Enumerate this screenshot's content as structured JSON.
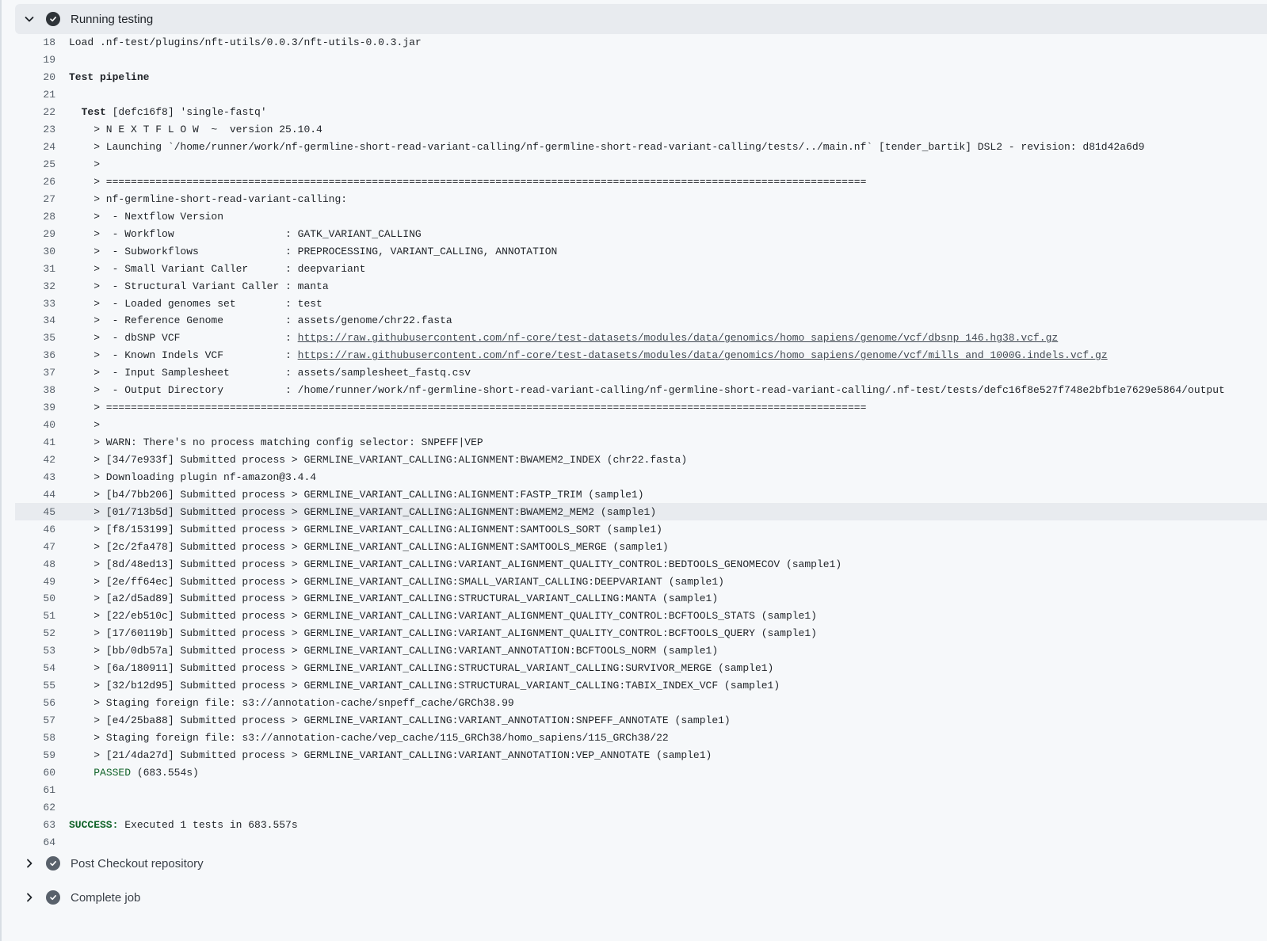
{
  "steps": {
    "running": {
      "title": "Running testing",
      "state": "expanded"
    },
    "post_checkout": {
      "title": "Post Checkout repository",
      "state": "collapsed"
    },
    "complete": {
      "title": "Complete job",
      "state": "collapsed"
    }
  },
  "highlighted_line": "45",
  "log_lines": [
    {
      "n": "18",
      "t": "Load .nf-test/plugins/nft-utils/0.0.3/nft-utils-0.0.3.jar"
    },
    {
      "n": "19",
      "t": ""
    },
    {
      "n": "20",
      "p": "Test pipeline"
    },
    {
      "n": "21",
      "t": ""
    },
    {
      "n": "22",
      "t": "  ",
      "p": "Test",
      "t2": " [defc16f8] 'single-fastq'"
    },
    {
      "n": "23",
      "t": "    > N E X T F L O W  ~  version 25.10.4"
    },
    {
      "n": "24",
      "t": "    > Launching `/home/runner/work/nf-germline-short-read-variant-calling/nf-germline-short-read-variant-calling/tests/../main.nf` [tender_bartik] DSL2 - revision: d81d42a6d9"
    },
    {
      "n": "25",
      "t": "    >"
    },
    {
      "n": "26",
      "t": "    > ==========================================================================================================================="
    },
    {
      "n": "27",
      "t": "    > nf-germline-short-read-variant-calling:"
    },
    {
      "n": "28",
      "t": "    >  - Nextflow Version"
    },
    {
      "n": "29",
      "t": "    >  - Workflow                  : GATK_VARIANT_CALLING"
    },
    {
      "n": "30",
      "t": "    >  - Subworkflows              : PREPROCESSING, VARIANT_CALLING, ANNOTATION"
    },
    {
      "n": "31",
      "t": "    >  - Small Variant Caller      : deepvariant"
    },
    {
      "n": "32",
      "t": "    >  - Structural Variant Caller : manta"
    },
    {
      "n": "33",
      "t": "    >  - Loaded genomes set        : test"
    },
    {
      "n": "34",
      "t": "    >  - Reference Genome          : assets/genome/chr22.fasta"
    },
    {
      "n": "35",
      "t": "    >  - dbSNP VCF                 : ",
      "l": "https://raw.githubusercontent.com/nf-core/test-datasets/modules/data/genomics/homo_sapiens/genome/vcf/dbsnp_146.hg38.vcf.gz"
    },
    {
      "n": "36",
      "t": "    >  - Known Indels VCF          : ",
      "l": "https://raw.githubusercontent.com/nf-core/test-datasets/modules/data/genomics/homo_sapiens/genome/vcf/mills_and_1000G.indels.vcf.gz"
    },
    {
      "n": "37",
      "t": "    >  - Input Samplesheet         : assets/samplesheet_fastq.csv"
    },
    {
      "n": "38",
      "t": "    >  - Output Directory          : /home/runner/work/nf-germline-short-read-variant-calling/nf-germline-short-read-variant-calling/.nf-test/tests/defc16f8e527f748e2bfb1e7629e5864/output"
    },
    {
      "n": "39",
      "t": "    > ==========================================================================================================================="
    },
    {
      "n": "40",
      "t": "    >"
    },
    {
      "n": "41",
      "t": "    > WARN: There's no process matching config selector: SNPEFF|VEP"
    },
    {
      "n": "42",
      "t": "    > [34/7e933f] Submitted process > GERMLINE_VARIANT_CALLING:ALIGNMENT:BWAMEM2_INDEX (chr22.fasta)"
    },
    {
      "n": "43",
      "t": "    > Downloading plugin nf-amazon@3.4.4"
    },
    {
      "n": "44",
      "t": "    > [b4/7bb206] Submitted process > GERMLINE_VARIANT_CALLING:ALIGNMENT:FASTP_TRIM (sample1)"
    },
    {
      "n": "45",
      "t": "    > [01/713b5d] Submitted process > GERMLINE_VARIANT_CALLING:ALIGNMENT:BWAMEM2_MEM2 (sample1)"
    },
    {
      "n": "46",
      "t": "    > [f8/153199] Submitted process > GERMLINE_VARIANT_CALLING:ALIGNMENT:SAMTOOLS_SORT (sample1)"
    },
    {
      "n": "47",
      "t": "    > [2c/2fa478] Submitted process > GERMLINE_VARIANT_CALLING:ALIGNMENT:SAMTOOLS_MERGE (sample1)"
    },
    {
      "n": "48",
      "t": "    > [8d/48ed13] Submitted process > GERMLINE_VARIANT_CALLING:VARIANT_ALIGNMENT_QUALITY_CONTROL:BEDTOOLS_GENOMECOV (sample1)"
    },
    {
      "n": "49",
      "t": "    > [2e/ff64ec] Submitted process > GERMLINE_VARIANT_CALLING:SMALL_VARIANT_CALLING:DEEPVARIANT (sample1)"
    },
    {
      "n": "50",
      "t": "    > [a2/d5ad89] Submitted process > GERMLINE_VARIANT_CALLING:STRUCTURAL_VARIANT_CALLING:MANTA (sample1)"
    },
    {
      "n": "51",
      "t": "    > [22/eb510c] Submitted process > GERMLINE_VARIANT_CALLING:VARIANT_ALIGNMENT_QUALITY_CONTROL:BCFTOOLS_STATS (sample1)"
    },
    {
      "n": "52",
      "t": "    > [17/60119b] Submitted process > GERMLINE_VARIANT_CALLING:VARIANT_ALIGNMENT_QUALITY_CONTROL:BCFTOOLS_QUERY (sample1)"
    },
    {
      "n": "53",
      "t": "    > [bb/0db57a] Submitted process > GERMLINE_VARIANT_CALLING:VARIANT_ANNOTATION:BCFTOOLS_NORM (sample1)"
    },
    {
      "n": "54",
      "t": "    > [6a/180911] Submitted process > GERMLINE_VARIANT_CALLING:STRUCTURAL_VARIANT_CALLING:SURVIVOR_MERGE (sample1)"
    },
    {
      "n": "55",
      "t": "    > [32/b12d95] Submitted process > GERMLINE_VARIANT_CALLING:STRUCTURAL_VARIANT_CALLING:TABIX_INDEX_VCF (sample1)"
    },
    {
      "n": "56",
      "t": "    > Staging foreign file: s3://annotation-cache/snpeff_cache/GRCh38.99"
    },
    {
      "n": "57",
      "t": "    > [e4/25ba88] Submitted process > GERMLINE_VARIANT_CALLING:VARIANT_ANNOTATION:SNPEFF_ANNOTATE (sample1)"
    },
    {
      "n": "58",
      "t": "    > Staging foreign file: s3://annotation-cache/vep_cache/115_GRCh38/homo_sapiens/115_GRCh38/22"
    },
    {
      "n": "59",
      "t": "    > [21/4da27d] Submitted process > GERMLINE_VARIANT_CALLING:VARIANT_ANNOTATION:VEP_ANNOTATE (sample1)"
    },
    {
      "n": "60",
      "t": "    ",
      "g": "PASSED",
      "t2": " (683.554s)"
    },
    {
      "n": "61",
      "t": ""
    },
    {
      "n": "62",
      "t": ""
    },
    {
      "n": "63",
      "s": "SUCCESS:",
      "t2": " Executed 1 tests in 683.557s"
    },
    {
      "n": "64",
      "t": ""
    }
  ]
}
